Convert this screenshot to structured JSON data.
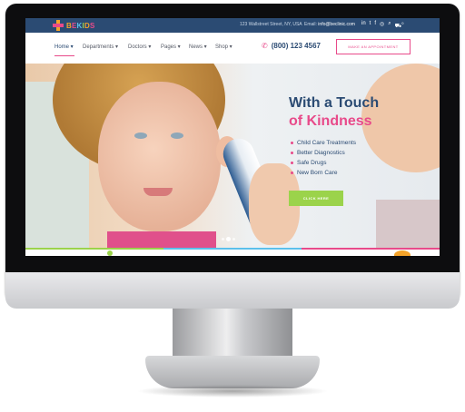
{
  "brand": {
    "logo_text": [
      "B",
      "E",
      "K",
      "I",
      "D",
      "S"
    ]
  },
  "topbar": {
    "address": "123 Wallstreet Street, NY, USA",
    "email_label": "Email:",
    "email": "info@beclinic.com",
    "social_icons": [
      "linkedin-icon",
      "twitter-icon",
      "facebook-icon",
      "instagram-icon",
      "search-icon",
      "cart-icon"
    ],
    "icon_glyphs": [
      "in",
      "t",
      "f",
      "◎",
      "⌕",
      "⛟"
    ],
    "cart_count": "0"
  },
  "nav": {
    "items": [
      "Home",
      "Departments",
      "Doctors",
      "Pages",
      "News",
      "Shop"
    ],
    "phone": "(800) 123 4567",
    "appointment_button": "MAKE AN APPOINTMENT"
  },
  "hero": {
    "title_line1": "With a Touch",
    "title_line2": "of Kindness",
    "bullets": [
      "Child Care Treatments",
      "Better Diagnostics",
      "Safe Drugs",
      "New Born Care"
    ],
    "cta_label": "CLICK HERE",
    "slider_dots": 3,
    "active_dot": 1
  },
  "colors": {
    "primary": "#2b4b73",
    "accent": "#e84a8a",
    "green": "#9bd34b",
    "orange": "#f4a32a",
    "blue": "#5bc0eb"
  }
}
